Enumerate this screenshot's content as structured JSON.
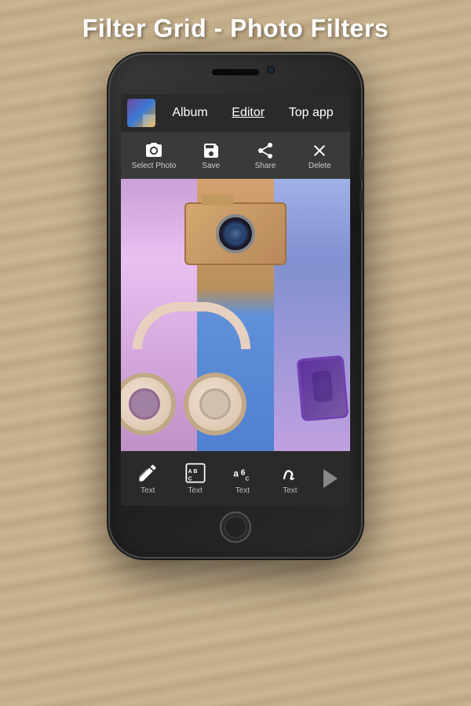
{
  "page": {
    "title": "Filter Grid - Photo Filters",
    "bg_color": "#c8b89a"
  },
  "nav": {
    "tabs": [
      {
        "id": "album",
        "label": "Album",
        "active": false
      },
      {
        "id": "editor",
        "label": "Editor",
        "active": true
      },
      {
        "id": "topapp",
        "label": "Top app",
        "active": false
      }
    ]
  },
  "toolbar": {
    "items": [
      {
        "id": "select-photo",
        "label": "Select Photo",
        "icon": "camera"
      },
      {
        "id": "save",
        "label": "Save",
        "icon": "save"
      },
      {
        "id": "share",
        "label": "Share",
        "icon": "share"
      },
      {
        "id": "delete",
        "label": "Delete",
        "icon": "close"
      }
    ]
  },
  "bottom_bar": {
    "items": [
      {
        "id": "text1",
        "label": "Text",
        "icon": "text-edit"
      },
      {
        "id": "text2",
        "label": "Text",
        "icon": "text-abc"
      },
      {
        "id": "text3",
        "label": "Text",
        "icon": "text-abc-script"
      },
      {
        "id": "text4",
        "label": "Text",
        "icon": "text-cursive"
      }
    ],
    "next_label": "Next"
  }
}
